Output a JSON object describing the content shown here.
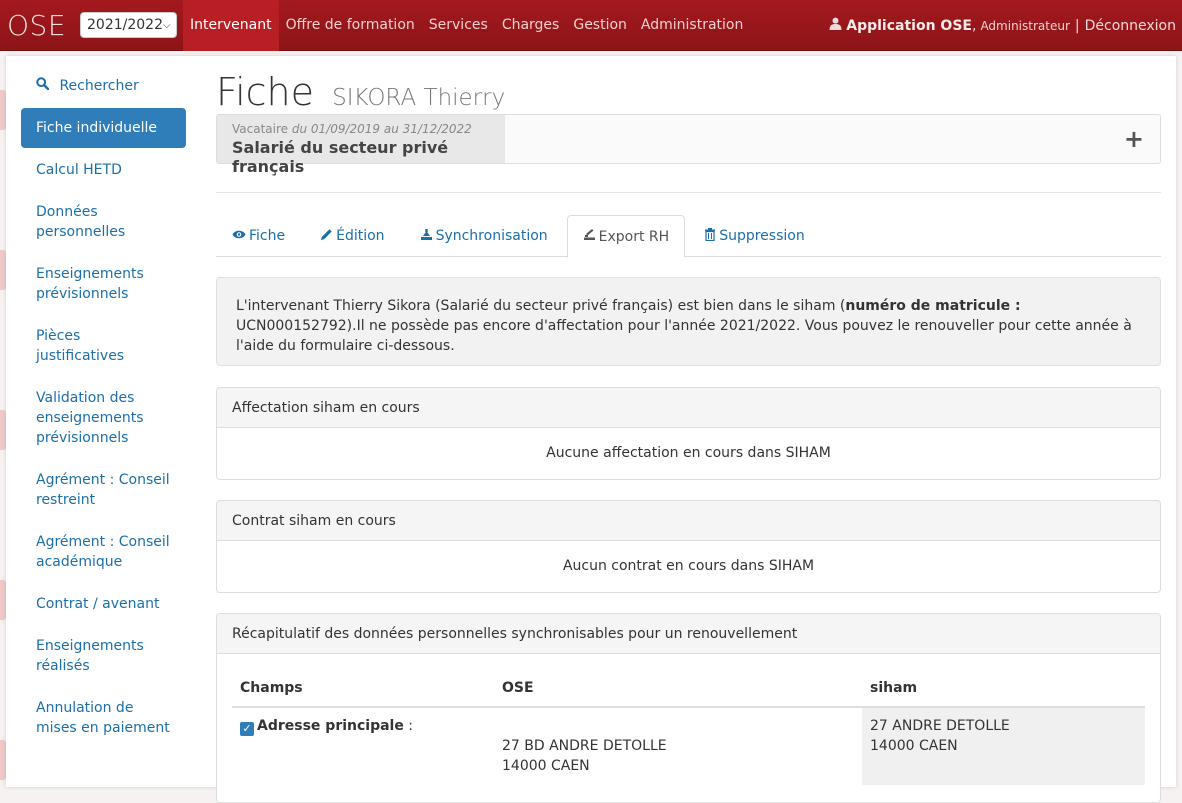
{
  "navbar": {
    "brand": "OSE",
    "year": "2021/2022",
    "items": [
      {
        "label": "Intervenant",
        "active": true
      },
      {
        "label": "Offre de formation"
      },
      {
        "label": "Services"
      },
      {
        "label": "Charges"
      },
      {
        "label": "Gestion"
      },
      {
        "label": "Administration"
      }
    ],
    "user_name": "Application OSE",
    "user_comma": ",",
    "user_role": "Administrateur",
    "separator": "|",
    "logout": "Déconnexion",
    "icons": {
      "user": "user-icon",
      "year_select": "chevron-down-icon"
    }
  },
  "sidebar": {
    "search": "Rechercher",
    "items": [
      {
        "label": "Fiche individuelle",
        "active": true
      },
      {
        "label": "Calcul HETD"
      },
      {
        "label": "Données personnelles"
      },
      {
        "label": "Enseignements prévisionnels"
      },
      {
        "label": "Pièces justificatives"
      },
      {
        "label": "Validation des enseignements prévisionnels"
      },
      {
        "label": "Agrément : Conseil restreint"
      },
      {
        "label": "Agrément : Conseil académique"
      },
      {
        "label": "Contrat / avenant"
      },
      {
        "label": "Enseignements réalisés"
      },
      {
        "label": "Annulation de mises en paiement"
      }
    ]
  },
  "page": {
    "title": "Fiche",
    "subtitle": "SIKORA Thierry"
  },
  "status": {
    "kind": "Vacataire",
    "period": "du 01/09/2019 au 31/12/2022",
    "statut": "Salarié du secteur privé français",
    "plus": "+"
  },
  "tabs": [
    {
      "label": "Fiche",
      "icon": "eye-icon"
    },
    {
      "label": "Édition",
      "icon": "pencil-icon"
    },
    {
      "label": "Synchronisation",
      "icon": "sync-icon"
    },
    {
      "label": "Export RH",
      "icon": "export-icon",
      "active": true
    },
    {
      "label": "Suppression",
      "icon": "trash-icon"
    }
  ],
  "info": {
    "text_before": "L'intervenant Thierry Sikora (Salarié du secteur privé français) est bien dans le siham (",
    "matricule_label": "numéro de matricule :",
    "text_after": " UCN000152792).Il ne possède pas encore d'affectation pour l'année 2021/2022. Vous pouvez le renouveller pour cette année à l'aide du formulaire ci-dessous."
  },
  "panels": {
    "affectation": {
      "heading": "Affectation siham en cours",
      "body": "Aucune affectation en cours dans SIHAM"
    },
    "contrat": {
      "heading": "Contrat siham en cours",
      "body": "Aucun contrat en cours dans SIHAM"
    },
    "recap": {
      "heading": "Récapitulatif des données personnelles synchronisables pour un renouvellement"
    }
  },
  "table": {
    "headers": {
      "champs": "Champs",
      "ose": "OSE",
      "siham": "siham"
    },
    "rows": [
      {
        "champ": "Adresse principale",
        "colon": ":",
        "checked": true,
        "ose_line1": "27 BD ANDRE DETOLLE",
        "ose_line2": "14000 CAEN",
        "siham_line1": "27 ANDRE DETOLLE",
        "siham_line2": "14000 CAEN"
      }
    ]
  },
  "colors": {
    "navbar": "#a3191e",
    "active_nav": "#b71f24",
    "link": "#1b6fa8",
    "active_sidebar": "#2f7db9"
  }
}
